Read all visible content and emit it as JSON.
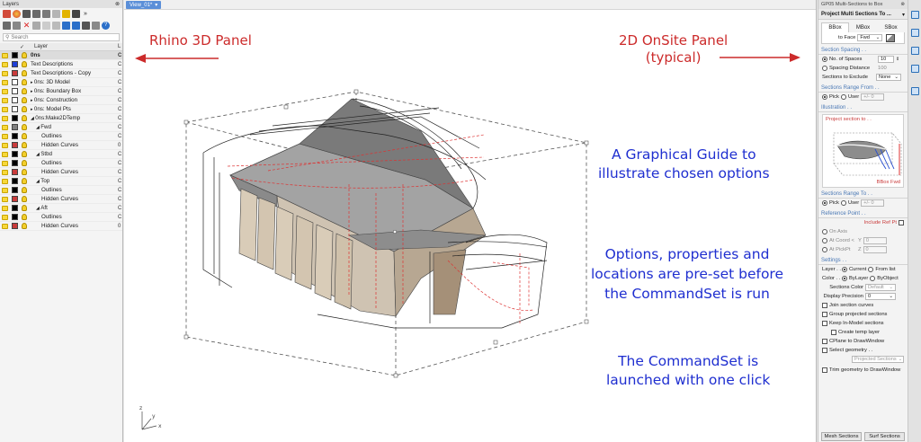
{
  "layers_panel": {
    "title": "Layers",
    "search_placeholder": "Search",
    "col_layer": "Layer",
    "col_extra": "L",
    "rows": [
      {
        "name": "0ns",
        "color": "#000000",
        "current": true,
        "indent": 0,
        "c": "C"
      },
      {
        "name": "Text Descriptions",
        "color": "#1f3fd6",
        "indent": 0,
        "c": "C"
      },
      {
        "name": "Text Descriptions - Copy",
        "color": "#c93b3b",
        "indent": 0,
        "c": "C"
      },
      {
        "name": "0ns: 3D Model",
        "color": "#ffffff",
        "indent": 0,
        "exp": "▸",
        "c": "C"
      },
      {
        "name": "0ns: Boundary Box",
        "color": "#ffffff",
        "indent": 0,
        "exp": "▸",
        "c": "C"
      },
      {
        "name": "0ns: Construction",
        "color": "#ffffff",
        "indent": 0,
        "exp": "▸",
        "c": "C"
      },
      {
        "name": "0ns: Model Pts",
        "color": "#ffffff",
        "indent": 0,
        "exp": "▸",
        "c": "C"
      },
      {
        "name": "0ns:Make2DTemp",
        "color": "#000000",
        "indent": 0,
        "exp": "◢",
        "c": "C"
      },
      {
        "name": "Fwd",
        "color": "#808080",
        "indent": 1,
        "exp": "◢",
        "c": "C"
      },
      {
        "name": "Outlines",
        "color": "#000000",
        "indent": 2,
        "c": "C"
      },
      {
        "name": "Hidden Curves",
        "color": "#c93b3b",
        "indent": 2,
        "c": "0"
      },
      {
        "name": "Stbd",
        "color": "#000000",
        "indent": 1,
        "exp": "◢",
        "c": "C"
      },
      {
        "name": "Outlines",
        "color": "#000000",
        "indent": 2,
        "c": "C"
      },
      {
        "name": "Hidden Curves",
        "color": "#c93b3b",
        "indent": 2,
        "c": "C"
      },
      {
        "name": "Top",
        "color": "#000000",
        "indent": 1,
        "exp": "◢",
        "c": "C"
      },
      {
        "name": "Outlines",
        "color": "#000000",
        "indent": 2,
        "c": "C"
      },
      {
        "name": "Hidden Curves",
        "color": "#c93b3b",
        "indent": 2,
        "c": "C"
      },
      {
        "name": "Aft",
        "color": "#000000",
        "indent": 1,
        "exp": "◢",
        "c": "C"
      },
      {
        "name": "Outlines",
        "color": "#000000",
        "indent": 2,
        "c": "C"
      },
      {
        "name": "Hidden Curves",
        "color": "#c93b3b",
        "indent": 2,
        "c": "0"
      }
    ]
  },
  "viewport": {
    "tab_label": "View_01*",
    "annotations": {
      "rhino_panel": "Rhino 3D Panel",
      "onsite_panel_1": "2D OnSite Panel",
      "onsite_panel_2": "(typical)",
      "guide_1": "A Graphical Guide to",
      "guide_2": "illustrate chosen options",
      "options_1": "Options, properties and",
      "options_2": "locations are pre-set before",
      "options_3": "the CommandSet is run",
      "launch_1": "The CommandSet is",
      "launch_2": "launched with one click"
    },
    "axis_labels": {
      "x": "x",
      "y": "y",
      "z": "z"
    }
  },
  "right_panel": {
    "title": "GP05 Multi-Sections to Box",
    "heading": "Project Multi Sections To ...",
    "tabs": [
      "BBox",
      "MBox",
      "SBox"
    ],
    "to_face_label": "to Face",
    "to_face_value": "Fwd",
    "section_spacing_title": "Section Spacing . .",
    "no_of_spaces_label": "No. of Spaces",
    "no_of_spaces_value": "10",
    "spacing_distance_label": "Spacing Distance",
    "spacing_distance_value": "100",
    "sections_to_exclude_label": "Sections to Exclude",
    "sections_to_exclude_value": "None",
    "range_from_title": "Sections Range From . .",
    "pick_label": "Pick",
    "user_label": "User",
    "range_placeholder": "+/- 0",
    "illustration_title": "Illustration . .",
    "illus_caption_top": "Project section to . .",
    "illus_caption_bottom": "BBox Fwd",
    "range_to_title": "Sections Range To . .",
    "reference_title": "Reference Point . .",
    "include_ref_label": "Include Ref Pt",
    "on_axis_label": "On Axis",
    "at_coord_label": "At Coord <",
    "at_pickpt_label": "At PickPt",
    "y_label": "Y",
    "y_value": "0",
    "z_label": "Z",
    "z_value": "0",
    "settings_title": "Settings . .",
    "layer_label": "Layer . .",
    "current_label": "Current",
    "from_list_label": "From list",
    "color_label": "Color . .",
    "bylayer_label": "ByLayer",
    "byobject_label": "ByObject",
    "sections_color_label": "Sections Color",
    "sections_color_value": "Default",
    "display_precision_label": "Display Precision",
    "display_precision_value": "0",
    "checks": [
      "Join section curves",
      "Group projected sections",
      "Keep In-Model sections"
    ],
    "create_temp_layer": "Create temp layer",
    "cplane_draw": "CPlane to DrawWindow",
    "select_geometry": "Select geometry . .",
    "projected_sections_value": "Projected Sections",
    "trim_geometry": "Trim geometry to DrawWindow",
    "mesh_button": "Mesh Sections",
    "surf_button": "Surf Sections"
  }
}
